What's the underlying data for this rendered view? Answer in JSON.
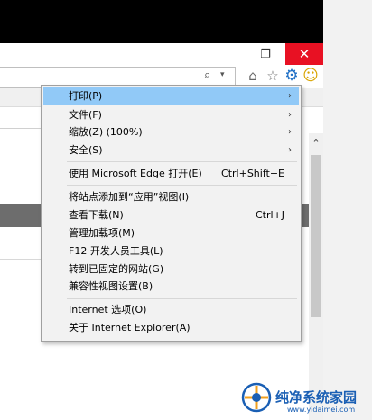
{
  "window": {
    "restore_glyph": "❐",
    "close_glyph": "✕"
  },
  "toolbar": {
    "search_glyph": "⌕",
    "dropdown_glyph": "▾",
    "home_glyph": "⌂",
    "star_glyph": "☆",
    "gear_glyph": "⚙",
    "smiley_glyph": "☺",
    "icons": [
      "search-icon",
      "home-icon",
      "star-icon",
      "gear-icon",
      "smiley-icon"
    ]
  },
  "menu": {
    "items": [
      {
        "label": "打印(P)",
        "shortcut": "",
        "arrow": "›"
      },
      {
        "label": "文件(F)",
        "shortcut": "",
        "arrow": "›"
      },
      {
        "label": "缩放(Z) (100%)",
        "shortcut": "",
        "arrow": "›"
      },
      {
        "label": "安全(S)",
        "shortcut": "",
        "arrow": "›"
      },
      {
        "label": "使用 Microsoft Edge 打开(E)",
        "shortcut": "Ctrl+Shift+E",
        "arrow": ""
      },
      {
        "label": "将站点添加到“应用”视图(I)",
        "shortcut": "",
        "arrow": ""
      },
      {
        "label": "查看下载(N)",
        "shortcut": "Ctrl+J",
        "arrow": ""
      },
      {
        "label": "管理加载项(M)",
        "shortcut": "",
        "arrow": ""
      },
      {
        "label": "F12 开发人员工具(L)",
        "shortcut": "",
        "arrow": ""
      },
      {
        "label": "转到已固定的网站(G)",
        "shortcut": "",
        "arrow": ""
      },
      {
        "label": "兼容性视图设置(B)",
        "shortcut": "",
        "arrow": ""
      },
      {
        "label": "Internet 选项(O)",
        "shortcut": "",
        "arrow": ""
      },
      {
        "label": "关于 Internet Explorer(A)",
        "shortcut": "",
        "arrow": ""
      }
    ]
  },
  "scrollbar": {
    "up_glyph": "⌃"
  },
  "watermark": {
    "title": "纯净系统家园",
    "url": "www.yidaimei.com"
  },
  "colors": {
    "highlight": "#91c9f7",
    "close_red": "#e81123",
    "gear_blue": "#1f6fc5"
  }
}
